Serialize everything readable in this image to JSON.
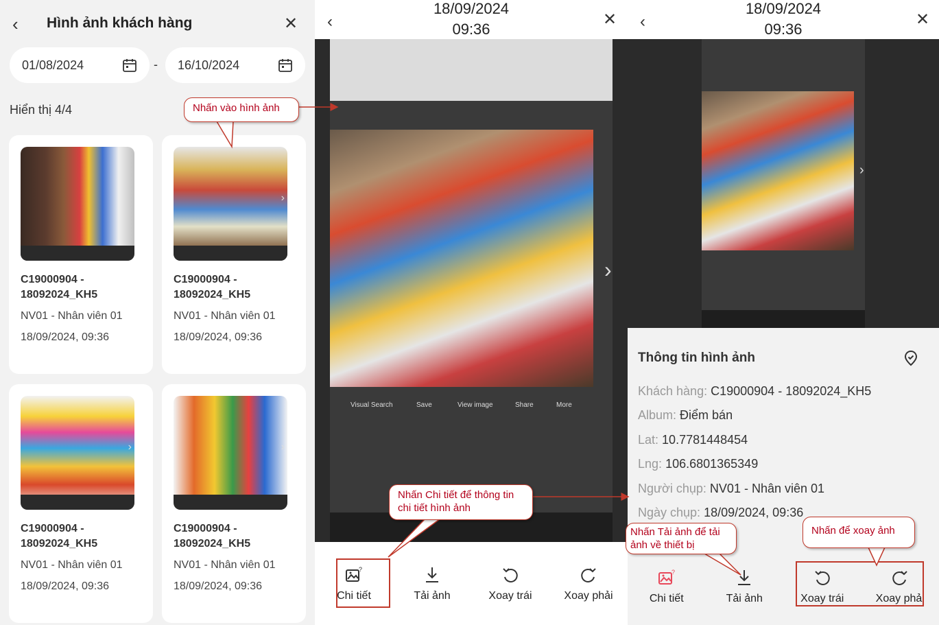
{
  "gallery": {
    "title": "Hình ảnh khách hàng",
    "date_from": "01/08/2024",
    "date_to": "16/10/2024",
    "date_separator": "-",
    "count": "Hiển thị 4/4",
    "cards": [
      {
        "code": "C19000904 - 18092024_KH5",
        "employee": "NV01 - Nhân viên 01",
        "time": "18/09/2024, 09:36"
      },
      {
        "code": "C19000904 - 18092024_KH5",
        "employee": "NV01 - Nhân viên 01",
        "time": "18/09/2024, 09:36"
      },
      {
        "code": "C19000904 - 18092024_KH5",
        "employee": "NV01 - Nhân viên 01",
        "time": "18/09/2024, 09:36"
      },
      {
        "code": "C19000904 - 18092024_KH5",
        "employee": "NV01 - Nhân viên 01",
        "time": "18/09/2024, 09:36"
      }
    ]
  },
  "viewer": {
    "date": "18/09/2024",
    "time": "09:36",
    "photo_toolbar": [
      "Visual Search",
      "Save",
      "View image",
      "Share",
      "More"
    ],
    "actions": {
      "detail": "Chi tiết",
      "download": "Tải ảnh",
      "rotate_left": "Xoay trái",
      "rotate_right": "Xoay phải"
    }
  },
  "info": {
    "date": "18/09/2024",
    "time": "09:36",
    "title": "Thông tin hình ảnh",
    "customer_label": "Khách hàng:",
    "customer_value": "C19000904 - 18092024_KH5",
    "album_label": "Album:",
    "album_value": "Điểm bán",
    "lat_label": "Lat:",
    "lat_value": "10.7781448454",
    "lng_label": "Lng:",
    "lng_value": "106.6801365349",
    "photographer_label": "Người chụp:",
    "photographer_value": "NV01 - Nhân viên 01",
    "date_label": "Ngày chụp:",
    "date_value": "18/09/2024, 09:36",
    "actions": {
      "detail": "Chi tiết",
      "download": "Tải ảnh",
      "rotate_left": "Xoay trái",
      "rotate_right": "Xoay phải"
    }
  },
  "annotations": {
    "tap_image": "Nhấn vào hình ảnh",
    "tap_detail": "Nhấn Chi tiết để thông tin chi tiết hình ảnh",
    "tap_download": "Nhấn Tải ảnh để tải ảnh về thiết bị",
    "tap_rotate": "Nhấn để xoay ảnh"
  },
  "colors": {
    "accent": "#e8485a",
    "annotation": "#c0392b",
    "panel_bg": "#f2f2f2"
  }
}
